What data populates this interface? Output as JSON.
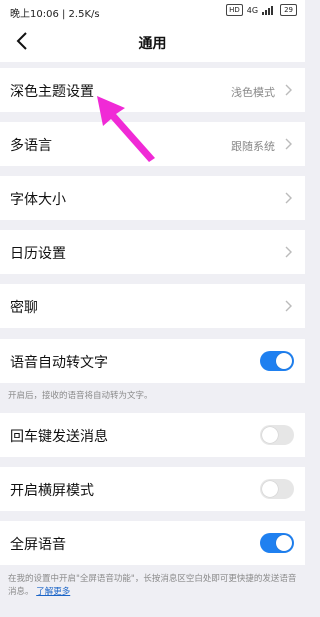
{
  "status_bar": {
    "left_text": "晚上10:06 | 2.5K/s",
    "sim_badge": "HD",
    "network": "4G",
    "battery": "29"
  },
  "navbar": {
    "title": "通用",
    "back_icon": "back-arrow-icon"
  },
  "rows": [
    {
      "label": "深色主题设置",
      "value": "浅色模式",
      "icon": "chevron-right-icon"
    },
    {
      "label": "多语言",
      "value": "跟随系统",
      "icon": "chevron-right-icon"
    },
    {
      "label": "字体大小",
      "value": "",
      "icon": "chevron-right-icon"
    },
    {
      "label": "日历设置",
      "value": "",
      "icon": "chevron-right-icon"
    },
    {
      "label": "密聊",
      "value": "",
      "icon": "chevron-right-icon"
    }
  ],
  "toggles": [
    {
      "label": "语音自动转文字",
      "on": true,
      "desc": "开启后，接收的语音将自动转为文字。"
    },
    {
      "label": "回车键发送消息",
      "on": false
    },
    {
      "label": "开启横屏模式",
      "on": false
    },
    {
      "label": "全屏语音",
      "on": true,
      "desc_part1": "在我的设置中开启\"全屏语音功能\"，长按消息区空白处即可更快捷的发送语音消息。",
      "desc_link": "了解更多"
    }
  ],
  "colors": {
    "accent": "#1f80f0",
    "annotation_arrow": "#f02ad6"
  }
}
